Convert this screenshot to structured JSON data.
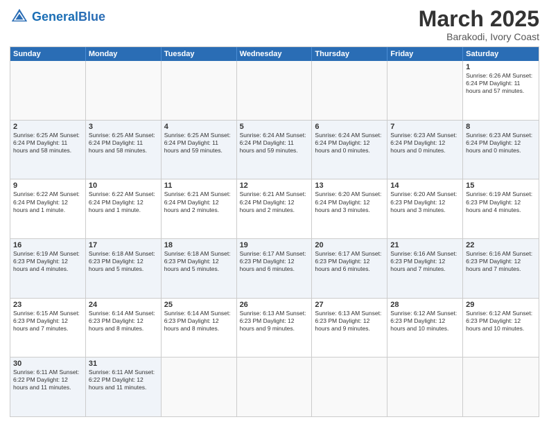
{
  "header": {
    "logo_general": "General",
    "logo_blue": "Blue",
    "month_title": "March 2025",
    "location": "Barakodi, Ivory Coast"
  },
  "day_headers": [
    "Sunday",
    "Monday",
    "Tuesday",
    "Wednesday",
    "Thursday",
    "Friday",
    "Saturday"
  ],
  "weeks": [
    [
      {
        "num": "",
        "info": "",
        "empty": true
      },
      {
        "num": "",
        "info": "",
        "empty": true
      },
      {
        "num": "",
        "info": "",
        "empty": true
      },
      {
        "num": "",
        "info": "",
        "empty": true
      },
      {
        "num": "",
        "info": "",
        "empty": true
      },
      {
        "num": "",
        "info": "",
        "empty": true
      },
      {
        "num": "1",
        "info": "Sunrise: 6:26 AM\nSunset: 6:24 PM\nDaylight: 11 hours\nand 57 minutes."
      }
    ],
    [
      {
        "num": "2",
        "info": "Sunrise: 6:25 AM\nSunset: 6:24 PM\nDaylight: 11 hours\nand 58 minutes."
      },
      {
        "num": "3",
        "info": "Sunrise: 6:25 AM\nSunset: 6:24 PM\nDaylight: 11 hours\nand 58 minutes."
      },
      {
        "num": "4",
        "info": "Sunrise: 6:25 AM\nSunset: 6:24 PM\nDaylight: 11 hours\nand 59 minutes."
      },
      {
        "num": "5",
        "info": "Sunrise: 6:24 AM\nSunset: 6:24 PM\nDaylight: 11 hours\nand 59 minutes."
      },
      {
        "num": "6",
        "info": "Sunrise: 6:24 AM\nSunset: 6:24 PM\nDaylight: 12 hours\nand 0 minutes."
      },
      {
        "num": "7",
        "info": "Sunrise: 6:23 AM\nSunset: 6:24 PM\nDaylight: 12 hours\nand 0 minutes."
      },
      {
        "num": "8",
        "info": "Sunrise: 6:23 AM\nSunset: 6:24 PM\nDaylight: 12 hours\nand 0 minutes."
      }
    ],
    [
      {
        "num": "9",
        "info": "Sunrise: 6:22 AM\nSunset: 6:24 PM\nDaylight: 12 hours\nand 1 minute."
      },
      {
        "num": "10",
        "info": "Sunrise: 6:22 AM\nSunset: 6:24 PM\nDaylight: 12 hours\nand 1 minute."
      },
      {
        "num": "11",
        "info": "Sunrise: 6:21 AM\nSunset: 6:24 PM\nDaylight: 12 hours\nand 2 minutes."
      },
      {
        "num": "12",
        "info": "Sunrise: 6:21 AM\nSunset: 6:24 PM\nDaylight: 12 hours\nand 2 minutes."
      },
      {
        "num": "13",
        "info": "Sunrise: 6:20 AM\nSunset: 6:24 PM\nDaylight: 12 hours\nand 3 minutes."
      },
      {
        "num": "14",
        "info": "Sunrise: 6:20 AM\nSunset: 6:23 PM\nDaylight: 12 hours\nand 3 minutes."
      },
      {
        "num": "15",
        "info": "Sunrise: 6:19 AM\nSunset: 6:23 PM\nDaylight: 12 hours\nand 4 minutes."
      }
    ],
    [
      {
        "num": "16",
        "info": "Sunrise: 6:19 AM\nSunset: 6:23 PM\nDaylight: 12 hours\nand 4 minutes."
      },
      {
        "num": "17",
        "info": "Sunrise: 6:18 AM\nSunset: 6:23 PM\nDaylight: 12 hours\nand 5 minutes."
      },
      {
        "num": "18",
        "info": "Sunrise: 6:18 AM\nSunset: 6:23 PM\nDaylight: 12 hours\nand 5 minutes."
      },
      {
        "num": "19",
        "info": "Sunrise: 6:17 AM\nSunset: 6:23 PM\nDaylight: 12 hours\nand 6 minutes."
      },
      {
        "num": "20",
        "info": "Sunrise: 6:17 AM\nSunset: 6:23 PM\nDaylight: 12 hours\nand 6 minutes."
      },
      {
        "num": "21",
        "info": "Sunrise: 6:16 AM\nSunset: 6:23 PM\nDaylight: 12 hours\nand 7 minutes."
      },
      {
        "num": "22",
        "info": "Sunrise: 6:16 AM\nSunset: 6:23 PM\nDaylight: 12 hours\nand 7 minutes."
      }
    ],
    [
      {
        "num": "23",
        "info": "Sunrise: 6:15 AM\nSunset: 6:23 PM\nDaylight: 12 hours\nand 7 minutes."
      },
      {
        "num": "24",
        "info": "Sunrise: 6:14 AM\nSunset: 6:23 PM\nDaylight: 12 hours\nand 8 minutes."
      },
      {
        "num": "25",
        "info": "Sunrise: 6:14 AM\nSunset: 6:23 PM\nDaylight: 12 hours\nand 8 minutes."
      },
      {
        "num": "26",
        "info": "Sunrise: 6:13 AM\nSunset: 6:23 PM\nDaylight: 12 hours\nand 9 minutes."
      },
      {
        "num": "27",
        "info": "Sunrise: 6:13 AM\nSunset: 6:23 PM\nDaylight: 12 hours\nand 9 minutes."
      },
      {
        "num": "28",
        "info": "Sunrise: 6:12 AM\nSunset: 6:23 PM\nDaylight: 12 hours\nand 10 minutes."
      },
      {
        "num": "29",
        "info": "Sunrise: 6:12 AM\nSunset: 6:23 PM\nDaylight: 12 hours\nand 10 minutes."
      }
    ],
    [
      {
        "num": "30",
        "info": "Sunrise: 6:11 AM\nSunset: 6:22 PM\nDaylight: 12 hours\nand 11 minutes."
      },
      {
        "num": "31",
        "info": "Sunrise: 6:11 AM\nSunset: 6:22 PM\nDaylight: 12 hours\nand 11 minutes."
      },
      {
        "num": "",
        "info": "",
        "empty": true
      },
      {
        "num": "",
        "info": "",
        "empty": true
      },
      {
        "num": "",
        "info": "",
        "empty": true
      },
      {
        "num": "",
        "info": "",
        "empty": true
      },
      {
        "num": "",
        "info": "",
        "empty": true
      }
    ]
  ]
}
